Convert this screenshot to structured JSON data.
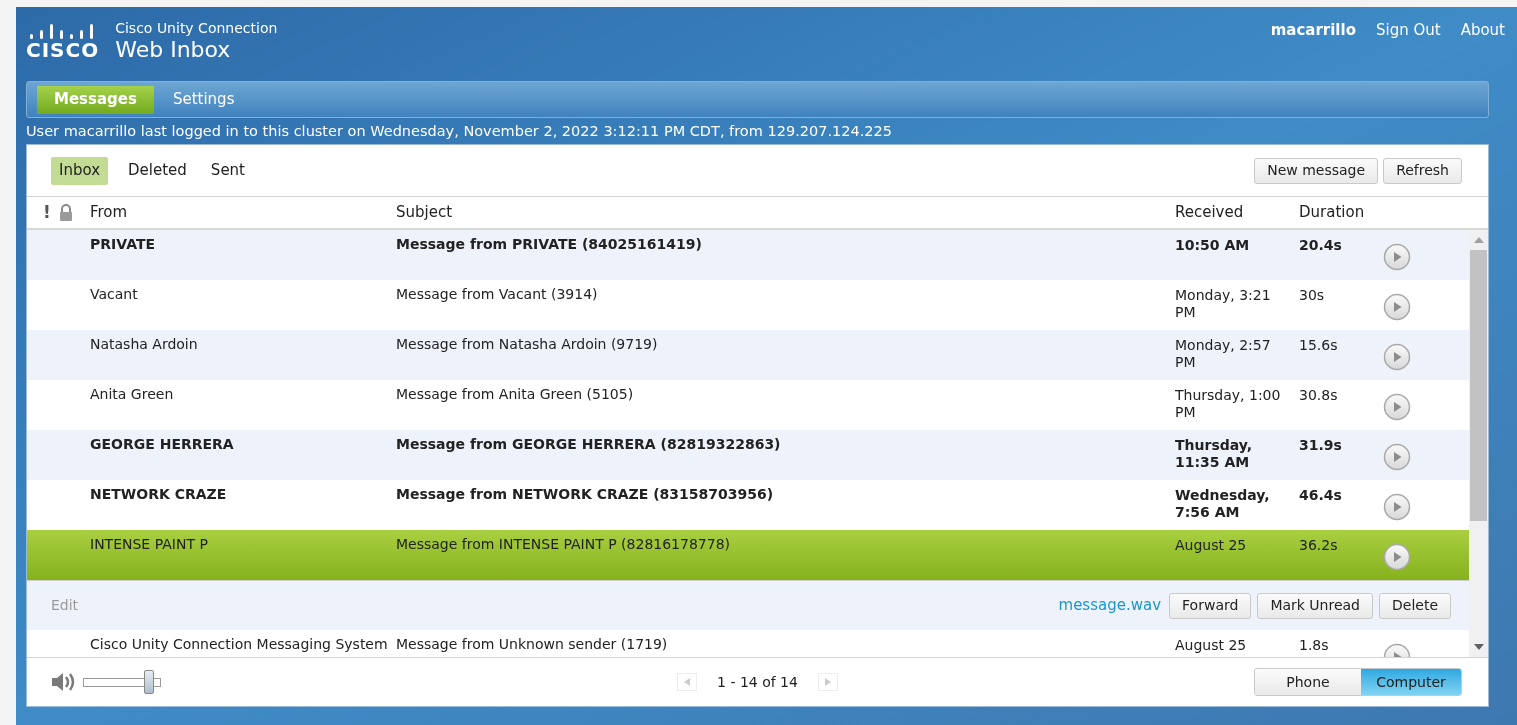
{
  "header": {
    "product": "Cisco Unity Connection",
    "title": "Web Inbox",
    "logo_text": "CISCO",
    "user": "macarrillo",
    "links": [
      "Sign Out",
      "About"
    ]
  },
  "nav_tabs": [
    {
      "label": "Messages",
      "selected": true
    },
    {
      "label": "Settings",
      "selected": false
    }
  ],
  "login_notice": "User macarrillo last logged in to this cluster on Wednesday, November 2, 2022 3:12:11 PM CDT, from 129.207.124.225",
  "folders": [
    {
      "label": "Inbox",
      "selected": true
    },
    {
      "label": "Deleted",
      "selected": false
    },
    {
      "label": "Sent",
      "selected": false
    }
  ],
  "toolbar_buttons": [
    "New message",
    "Refresh"
  ],
  "priority_header": "!",
  "columns": [
    "From",
    "Subject",
    "Received",
    "Duration"
  ],
  "rows": [
    {
      "from": "PRIVATE",
      "subject": "Message from PRIVATE (84025161419)",
      "received": "10:50 AM",
      "duration": "20.4s",
      "unread": true,
      "selected": false
    },
    {
      "from": "Vacant",
      "subject": "Message from Vacant (3914)",
      "received": "Monday, 3:21 PM",
      "duration": "30s",
      "unread": false,
      "selected": false
    },
    {
      "from": "Natasha Ardoin",
      "subject": "Message from Natasha Ardoin (9719)",
      "received": "Monday, 2:57 PM",
      "duration": "15.6s",
      "unread": false,
      "selected": false
    },
    {
      "from": "Anita Green",
      "subject": "Message from Anita Green (5105)",
      "received": "Thursday, 1:00 PM",
      "duration": "30.8s",
      "unread": false,
      "selected": false
    },
    {
      "from": "GEORGE HERRERA",
      "subject": "Message from GEORGE HERRERA (82819322863)",
      "received": "Thursday, 11:35 AM",
      "duration": "31.9s",
      "unread": true,
      "selected": false
    },
    {
      "from": "NETWORK CRAZE",
      "subject": "Message from NETWORK CRAZE (83158703956)",
      "received": "Wednesday, 7:56 AM",
      "duration": "46.4s",
      "unread": true,
      "selected": false
    },
    {
      "from": "INTENSE PAINT P",
      "subject": "Message from INTENSE PAINT P (82816178778)",
      "received": "August 25",
      "duration": "36.2s",
      "unread": false,
      "selected": true
    },
    {
      "from": "Cisco Unity Connection Messaging System",
      "subject": "Message from Unknown sender (1719)",
      "received": "August 25",
      "duration": "1.8s",
      "unread": false,
      "selected": false
    }
  ],
  "message_actions": {
    "edit": {
      "label": "Edit",
      "disabled": true
    },
    "attachment": "message.wav",
    "buttons": [
      "Forward",
      "Mark Unread",
      "Delete"
    ]
  },
  "volume": {
    "level": 0.84
  },
  "pagination": {
    "label": "1 - 14 of 14",
    "prev_disabled": true,
    "next_disabled": true
  },
  "playback": [
    {
      "label": "Phone",
      "selected": false
    },
    {
      "label": "Computer",
      "selected": true
    }
  ]
}
